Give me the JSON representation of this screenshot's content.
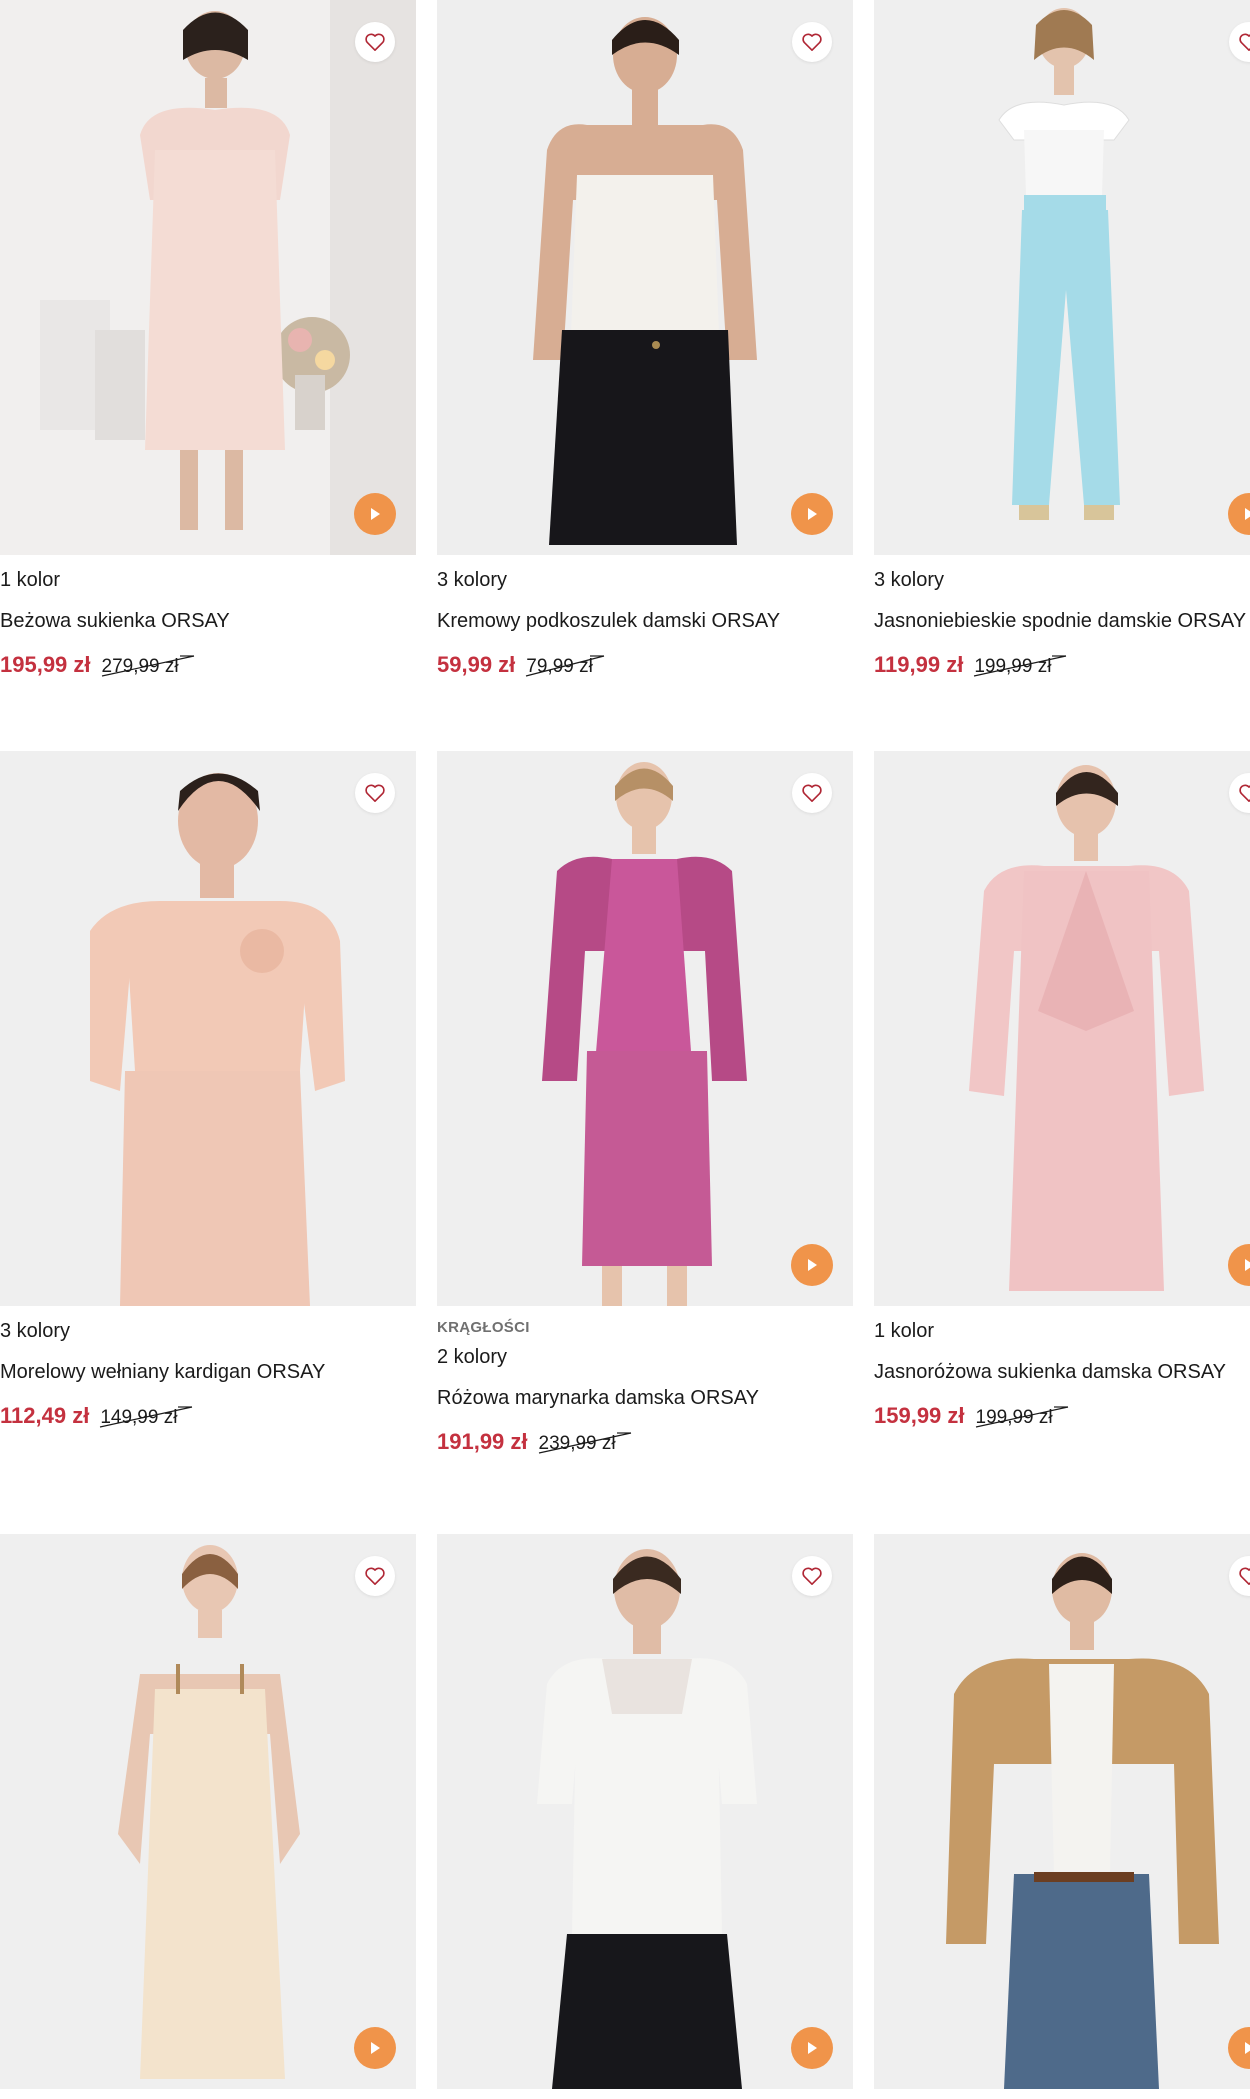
{
  "products": [
    {
      "colors": "1 kolor",
      "name": "Beżowa sukienka ORSAY",
      "price": "195,99 zł",
      "old_price": "279,99 zł",
      "tag": "",
      "has_play": true
    },
    {
      "colors": "3 kolory",
      "name": "Kremowy podkoszulek damski ORSAY",
      "price": "59,99 zł",
      "old_price": "79,99 zł",
      "tag": "",
      "has_play": true
    },
    {
      "colors": "3 kolory",
      "name": "Jasnoniebieskie spodnie damskie ORSAY",
      "price": "119,99 zł",
      "old_price": "199,99 zł",
      "tag": "",
      "has_play": true
    },
    {
      "colors": "3 kolory",
      "name": "Morelowy wełniany kardigan ORSAY",
      "price": "112,49 zł",
      "old_price": "149,99 zł",
      "tag": "",
      "has_play": false
    },
    {
      "colors": "2 kolory",
      "name": "Różowa marynarka damska ORSAY",
      "price": "191,99 zł",
      "old_price": "239,99 zł",
      "tag": "KRĄGŁOŚCI",
      "has_play": true
    },
    {
      "colors": "1 kolor",
      "name": "Jasnoróżowa sukienka damska ORSAY",
      "price": "159,99 zł",
      "old_price": "199,99 zł",
      "tag": "",
      "has_play": true
    },
    {
      "colors": "",
      "name": "",
      "price": "",
      "old_price": "",
      "tag": "",
      "has_play": true
    },
    {
      "colors": "",
      "name": "",
      "price": "",
      "old_price": "",
      "tag": "",
      "has_play": true
    },
    {
      "colors": "",
      "name": "",
      "price": "",
      "old_price": "",
      "tag": "",
      "has_play": true
    }
  ],
  "icons": {
    "wishlist": "heart-icon",
    "video": "play-icon"
  },
  "theme": {
    "sale_price": "#c4313f",
    "play_button": "#f0944a",
    "image_bg": "#efefef"
  }
}
